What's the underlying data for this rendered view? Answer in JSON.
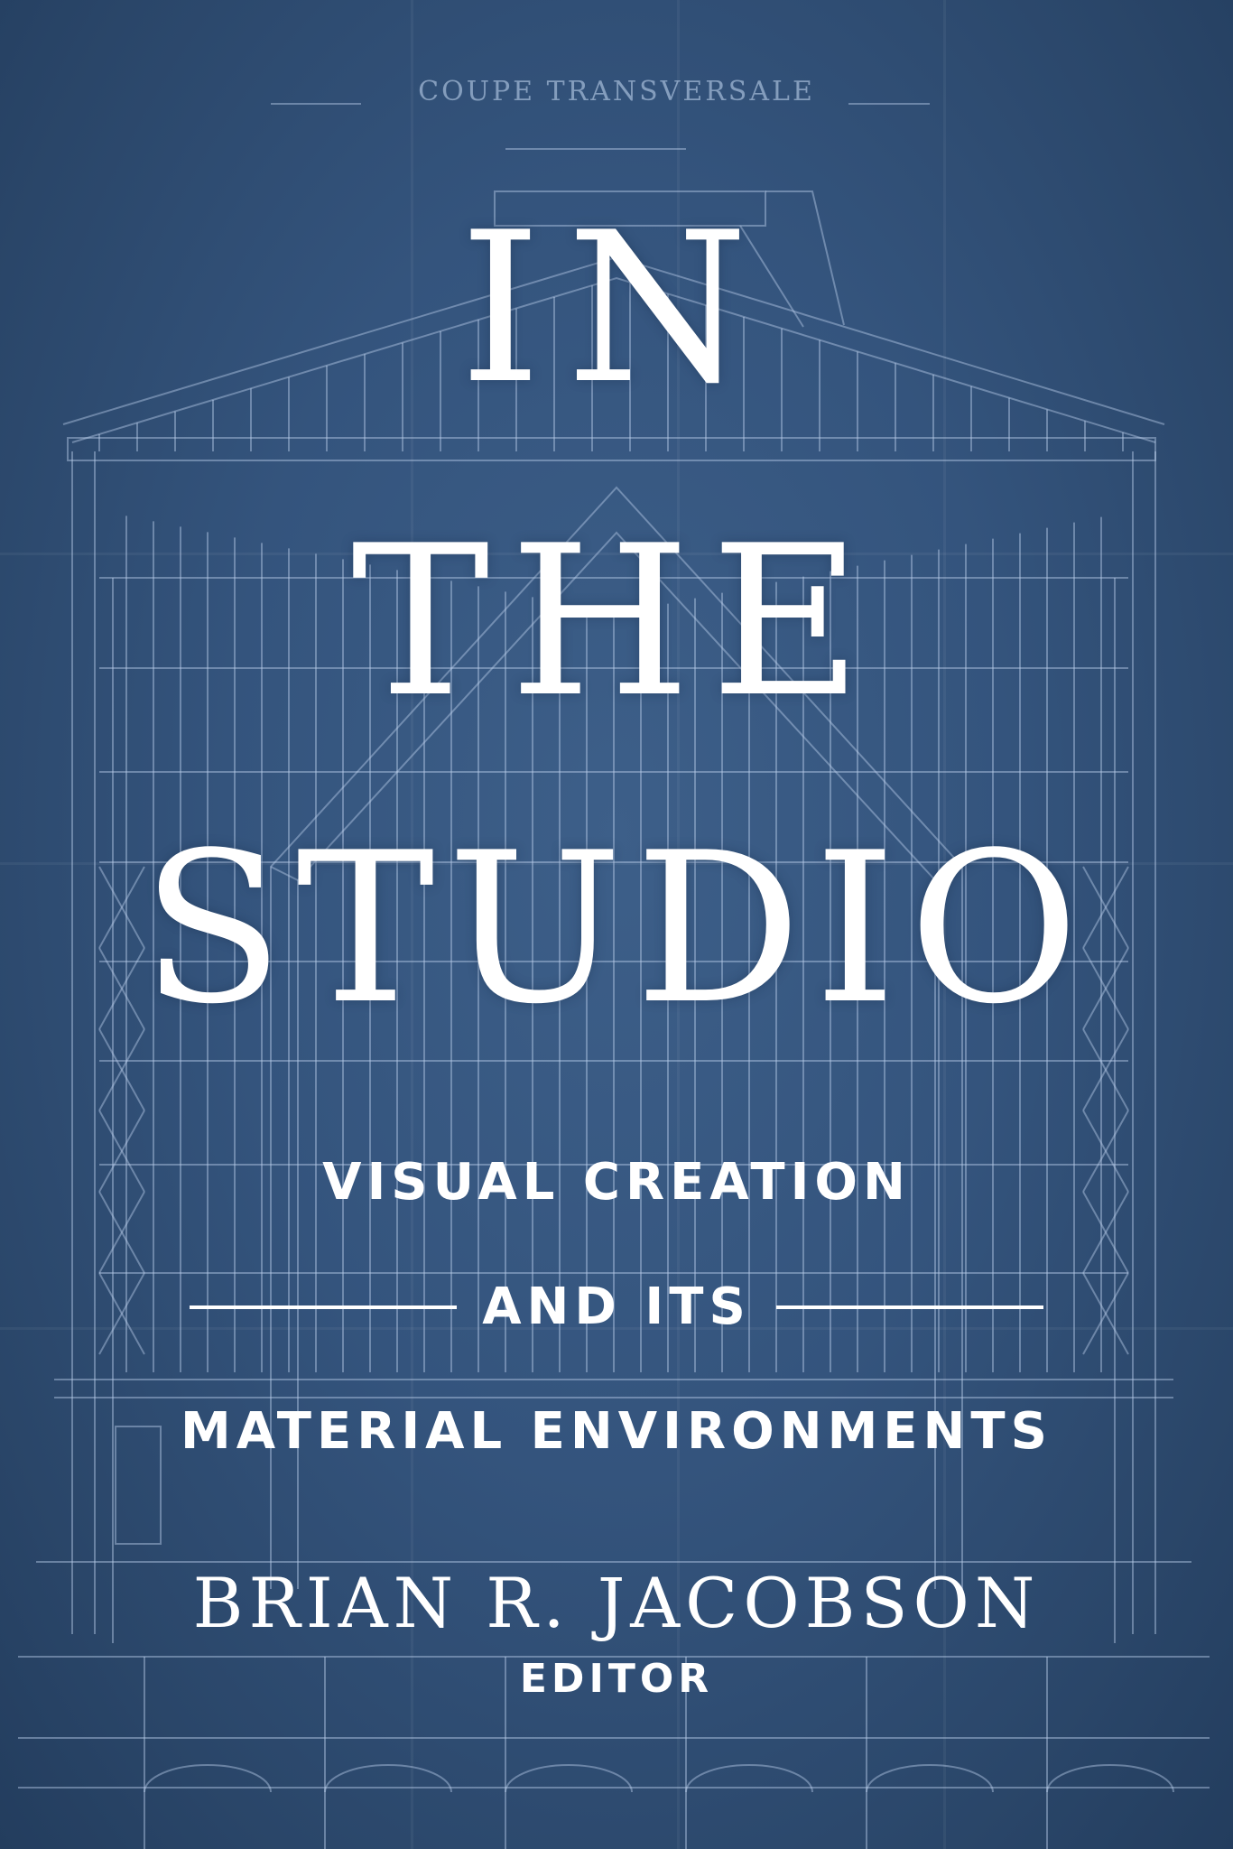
{
  "cover": {
    "background_color": "#34547d",
    "line_color": "#b7cde8",
    "text_color": "#ffffff",
    "blueprint_caption": "COUPE TRANSVERSALE",
    "title_lines": [
      "IN",
      "THE",
      "STUDIO"
    ],
    "subtitle": {
      "line1": "VISUAL CREATION",
      "line2": "AND ITS",
      "line3": "MATERIAL ENVIRONMENTS"
    },
    "author": "BRIAN R. JACOBSON",
    "author_role": "EDITOR"
  }
}
